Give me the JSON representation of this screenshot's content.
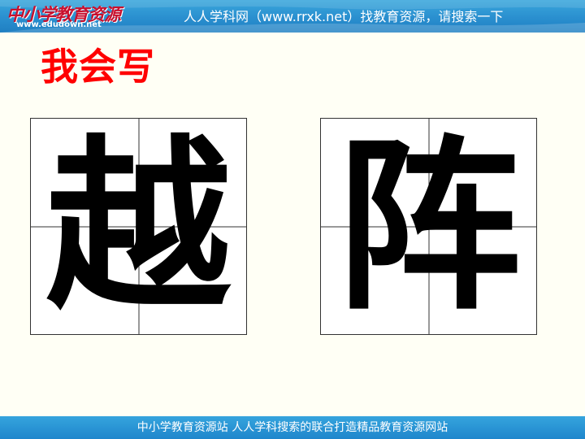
{
  "header": {
    "logo_text": "中小学教育资源",
    "logo_url": "www.edudown.net",
    "banner_text": "人人学科网（www.rrxk.net）找教育资源，请搜索一下"
  },
  "main": {
    "section_title": "我会写",
    "characters": [
      "越",
      "阵"
    ]
  },
  "footer": {
    "text": "中小学教育资源站 人人学科搜索的联合打造精品教育资源网站"
  },
  "colors": {
    "title": "#ff0000",
    "bar": "#2a8fcf",
    "logo": "#c8102e"
  }
}
